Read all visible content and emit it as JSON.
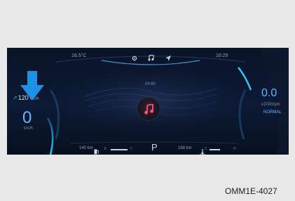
{
  "cluster": {
    "top_bar": {
      "outside_temperature": "16.5°C",
      "clock": "16:29",
      "icons": [
        "settings-icon",
        "music-note-icon",
        "navigation-arrow-icon"
      ]
    },
    "trip_time": "04:60",
    "speed_limit": {
      "value": "120",
      "unit": "km/h",
      "icon": "speed-limiter-icon"
    },
    "speed": {
      "value": "0",
      "unit": "km/h"
    },
    "rpm": {
      "value": "0.0",
      "unit": "x1000rpm"
    },
    "drive_mode": "NORMAL",
    "media": {
      "icon": "music-note-icon"
    },
    "bottom_bar": {
      "range_left": "140 km",
      "fuel": {
        "empty_label": "E",
        "full_label": "F",
        "icon": "fuel-pump-icon",
        "level": 0.85
      },
      "gear": "P",
      "range_right": "168 km",
      "coolant": {
        "cold_label": "C",
        "hot_label": "H",
        "icon": "coolant-temperature-icon",
        "level": 0.45
      }
    },
    "accent_color": "#5fb8ff",
    "callout_arrow_color": "#1e90e6"
  },
  "caption": "OMM1E-4027"
}
